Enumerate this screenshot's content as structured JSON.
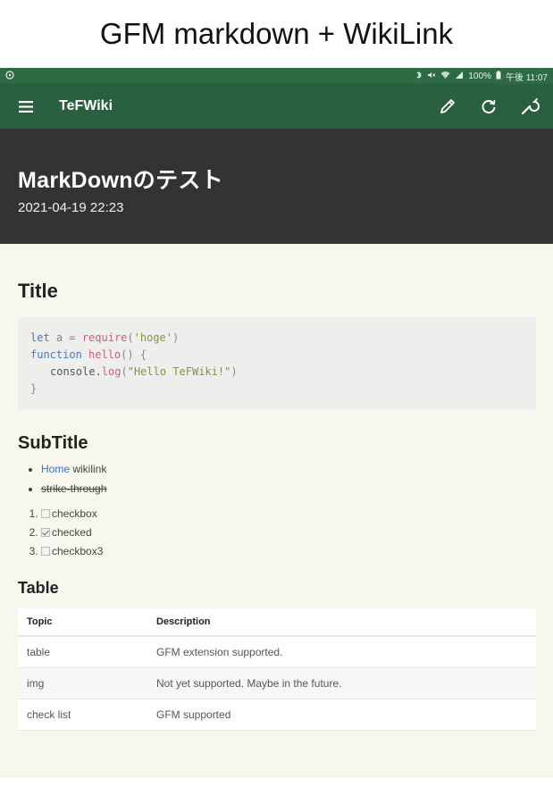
{
  "caption": "GFM markdown + WikiLink",
  "statusbar": {
    "battery": "100%",
    "time": "午後 11:07"
  },
  "appbar": {
    "title": "TeFWiki"
  },
  "page": {
    "title": "MarkDownのテスト",
    "date": "2021-04-19 22:23"
  },
  "content": {
    "h_title": "Title",
    "code": {
      "line1": {
        "kw": "let",
        "var": " a ",
        "op": "=",
        "fn": " require",
        "p1": "(",
        "str": "'hoge'",
        "p2": ")"
      },
      "line2": {
        "kw": "function",
        "fn": " hello",
        "p": "() {"
      },
      "line3": {
        "obj": "console.",
        "fn": "log",
        "p1": "(",
        "str": "\"Hello TeFWiki!\"",
        "p2": ")"
      },
      "line4": "}"
    },
    "h_subtitle": "SubTitle",
    "bullets": {
      "link": "Home",
      "link_rest": " wikilink",
      "strike": "strike-through"
    },
    "checklist": [
      {
        "label": "checkbox",
        "checked": false
      },
      {
        "label": "checked",
        "checked": true
      },
      {
        "label": "checkbox3",
        "checked": false
      }
    ],
    "h_table": "Table",
    "table": {
      "headers": [
        "Topic",
        "Description"
      ],
      "rows": [
        [
          "table",
          "GFM extension supported."
        ],
        [
          "img",
          "Not yet supported. Maybe in the future."
        ],
        [
          "check list",
          "GFM supported"
        ]
      ]
    }
  },
  "icons": [
    "menu-icon",
    "pencil-icon",
    "refresh-icon",
    "wrench-icon",
    "android-icon",
    "bluetooth-icon",
    "mute-icon",
    "wifi-icon",
    "signal-icon",
    "battery-icon"
  ],
  "colors": {
    "status_bar": "#2e6b44",
    "app_bar": "#2a6040",
    "hero": "#333333",
    "content_bg": "#f8f7ee",
    "link": "#3a6fc4"
  }
}
